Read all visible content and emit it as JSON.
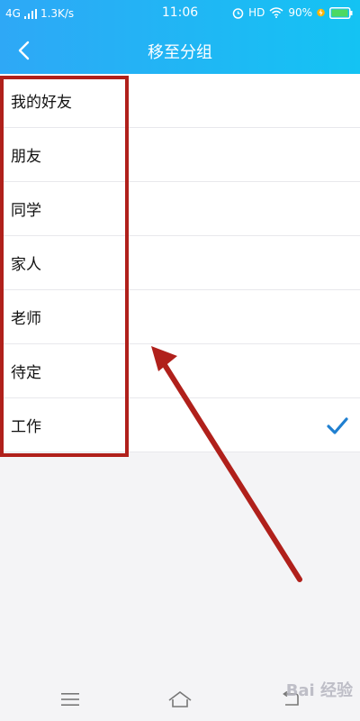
{
  "status_bar": {
    "network": "4G",
    "speed": "1.3K/s",
    "time": "11:06",
    "hd": "HD",
    "battery": "90%"
  },
  "header": {
    "title": "移至分组",
    "back_icon": "chevron-left-icon"
  },
  "groups": [
    {
      "label": "我的好友",
      "selected": false
    },
    {
      "label": "朋友",
      "selected": false
    },
    {
      "label": "同学",
      "selected": false
    },
    {
      "label": "家人",
      "selected": false
    },
    {
      "label": "老师",
      "selected": false
    },
    {
      "label": "待定",
      "selected": false
    },
    {
      "label": "工作",
      "selected": true
    }
  ],
  "colors": {
    "header_start": "#2ea8f6",
    "header_end": "#14c3f3",
    "check": "#1f7fd0",
    "annotation": "#b0201b"
  },
  "bottom_nav": {
    "icons": [
      "menu-icon",
      "home-icon",
      "back-icon"
    ]
  },
  "watermark": "Bai 经验"
}
